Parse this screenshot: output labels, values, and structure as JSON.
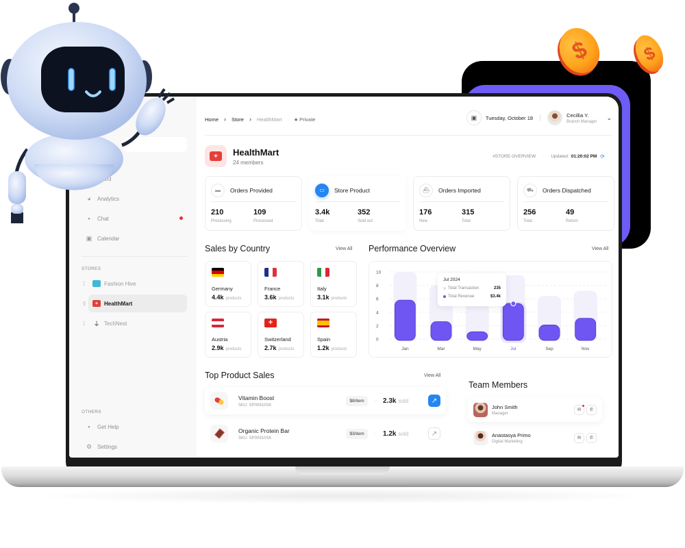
{
  "breadcrumb": {
    "items": [
      "Home",
      "Store"
    ],
    "current": "HealthMart",
    "visibility": "Private"
  },
  "header": {
    "date": "Tuesday, October 18",
    "user": {
      "name": "Cecillia Y.",
      "role": "Branch Manager"
    }
  },
  "sidebar": {
    "items": [
      {
        "label": "Dashboard",
        "visible_label": "board",
        "icon": "dashboard-icon"
      },
      {
        "label": "Analytics",
        "icon": "pie-chart-icon"
      },
      {
        "label": "Chat",
        "icon": "chat-icon",
        "notification": true
      },
      {
        "label": "Calendar",
        "icon": "calendar-icon"
      }
    ],
    "stores_heading": "STORES",
    "stores": [
      {
        "label": "Fashion Hive",
        "icon": "tshirt-icon",
        "color": "#3fb8d8"
      },
      {
        "label": "HealthMart",
        "icon": "medical-kit-icon",
        "color": "#e2403a",
        "active": true
      },
      {
        "label": "TechNest",
        "icon": "plug-icon",
        "color": "#222222"
      }
    ],
    "others_heading": "OTHERS",
    "others": [
      {
        "label": "Get Help",
        "icon": "help-chat-icon"
      },
      {
        "label": "Settings",
        "icon": "gear-icon"
      }
    ]
  },
  "store": {
    "name": "HealthMart",
    "members": "24 members",
    "tag": "#STORE-OVERVIEW",
    "updated_label": "Updated:",
    "updated_time": "01:20:02 PM"
  },
  "stats": [
    {
      "title": "Orders Provided",
      "icon": "inbox-icon",
      "values": [
        {
          "num": "210",
          "label": "Processing"
        },
        {
          "num": "109",
          "label": "Processed"
        }
      ]
    },
    {
      "title": "Store Product",
      "icon": "store-icon",
      "active": true,
      "values": [
        {
          "num": "3.4k",
          "label": "Total"
        },
        {
          "num": "352",
          "label": "Sold out"
        }
      ]
    },
    {
      "title": "Orders Imported",
      "icon": "ship-icon",
      "values": [
        {
          "num": "176",
          "label": "New"
        },
        {
          "num": "315",
          "label": "Total"
        }
      ]
    },
    {
      "title": "Orders Dispatched",
      "icon": "truck-icon",
      "values": [
        {
          "num": "256",
          "label": "Total"
        },
        {
          "num": "49",
          "label": "Return"
        }
      ]
    }
  ],
  "sales_by_country": {
    "title": "Sales by Country",
    "view_all": "View All",
    "unit": "products",
    "countries": [
      {
        "name": "Germany",
        "value": "4.4k"
      },
      {
        "name": "France",
        "value": "3.6k"
      },
      {
        "name": "Italy",
        "value": "3.1k"
      },
      {
        "name": "Austria",
        "value": "2.9k"
      },
      {
        "name": "Switzerland",
        "value": "2.7k"
      },
      {
        "name": "Spain",
        "value": "1.2k"
      }
    ]
  },
  "performance": {
    "title": "Performance Overview",
    "view_all": "View All",
    "tooltip": {
      "title": "Jul 2024",
      "rows": [
        {
          "label": "Total Transaction",
          "value": "235"
        },
        {
          "label": "Total Revenue",
          "value": "$3.4k"
        }
      ]
    }
  },
  "chart_data": {
    "type": "bar",
    "title": "Performance Overview",
    "categories": [
      "Jan",
      "Mar",
      "May",
      "Jul",
      "Sep",
      "Nov"
    ],
    "series": [
      {
        "name": "Total Transaction",
        "values": [
          10,
          8,
          9,
          9.5,
          6.4,
          7.2
        ],
        "color": "#f1f0fb"
      },
      {
        "name": "Total Revenue",
        "values": [
          5.8,
          2.6,
          1.1,
          5.3,
          2.1,
          3.1
        ],
        "color": "#6f56f2"
      }
    ],
    "highlighted": "Jul",
    "yticks": [
      0,
      2,
      4,
      6,
      8,
      10
    ],
    "ylim": [
      0,
      10
    ],
    "grid": true,
    "xlabel": "",
    "ylabel": ""
  },
  "top_products": {
    "title": "Top Product Sales",
    "view_all": "View All",
    "sold_label": "sold",
    "items": [
      {
        "name": "Vitamin Boost",
        "sku": "SKU: SP00910SK",
        "price": "$8/item",
        "sold": "2.3k",
        "icon": "pill-icon",
        "active": true
      },
      {
        "name": "Organic Protein Bar",
        "sku": "SKU: SP00910SK",
        "price": "$3/item",
        "sold": "1.2k",
        "icon": "protein-bar-icon"
      }
    ]
  },
  "team": {
    "title": "Team Members",
    "members": [
      {
        "name": "John Smith",
        "role": "Manager",
        "unread": true
      },
      {
        "name": "Anastasya Primo",
        "role": "Digital Marketing"
      }
    ]
  }
}
